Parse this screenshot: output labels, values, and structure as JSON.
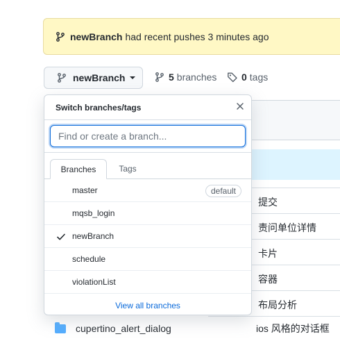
{
  "banner": {
    "branch": "newBranch",
    "message": "had recent pushes 3 minutes ago"
  },
  "branch_button": {
    "label": "newBranch"
  },
  "meta": {
    "branch_count": "5",
    "branch_label": "branches",
    "tag_count": "0",
    "tag_label": "tags"
  },
  "popup": {
    "title": "Switch branches/tags",
    "search_placeholder": "Find or create a branch...",
    "tabs": [
      "Branches",
      "Tags"
    ],
    "branches": [
      {
        "name": "master",
        "badge": "default"
      },
      {
        "name": "mqsb_login"
      },
      {
        "name": "newBranch",
        "selected": true
      },
      {
        "name": "schedule"
      },
      {
        "name": "violationList"
      }
    ],
    "view_all": "View all branches"
  },
  "background": {
    "descriptions": [
      "提交",
      "责问单位详情",
      "卡片",
      "容器",
      "布局分析"
    ],
    "file": {
      "name": "cupertino_alert_dialog",
      "desc": "ios 风格的对话框"
    }
  },
  "colors": {
    "banner_bg": "#fff8c5",
    "accent": "#0969da",
    "folder": "#54aeff"
  }
}
